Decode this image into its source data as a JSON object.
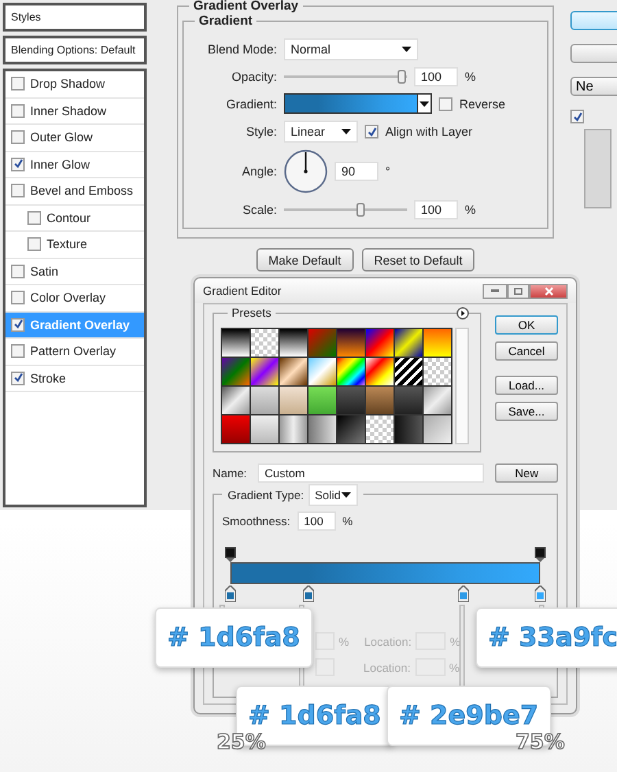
{
  "styles_panel": {
    "header": "Styles",
    "blending": "Blending Options: Default",
    "items": [
      {
        "label": "Drop Shadow",
        "checked": false,
        "selected": false
      },
      {
        "label": "Inner Shadow",
        "checked": false,
        "selected": false
      },
      {
        "label": "Outer Glow",
        "checked": false,
        "selected": false
      },
      {
        "label": "Inner Glow",
        "checked": true,
        "selected": false
      },
      {
        "label": "Bevel and Emboss",
        "checked": false,
        "selected": false,
        "children": [
          {
            "label": "Contour",
            "checked": false,
            "selected": false
          },
          {
            "label": "Texture",
            "checked": false,
            "selected": false
          }
        ]
      },
      {
        "label": "Satin",
        "checked": false,
        "selected": false
      },
      {
        "label": "Color Overlay",
        "checked": false,
        "selected": false
      },
      {
        "label": "Gradient Overlay",
        "checked": true,
        "selected": true
      },
      {
        "label": "Pattern Overlay",
        "checked": false,
        "selected": false
      },
      {
        "label": "Stroke",
        "checked": true,
        "selected": false
      }
    ]
  },
  "gradient_overlay": {
    "title": "Gradient Overlay",
    "section": "Gradient",
    "blend_mode": {
      "label": "Blend Mode:",
      "value": "Normal"
    },
    "opacity": {
      "label": "Opacity:",
      "level": 0.95,
      "value": "100",
      "unit": "%"
    },
    "gradient": {
      "label": "Gradient:",
      "reverse": {
        "label": "Reverse",
        "checked": false
      }
    },
    "style": {
      "label": "Style:",
      "value": "Linear",
      "align": {
        "label": "Align with Layer",
        "checked": true
      }
    },
    "angle": {
      "label": "Angle:",
      "value": "90",
      "unit": "°"
    },
    "scale": {
      "label": "Scale:",
      "level": 0.62,
      "value": "100",
      "unit": "%"
    },
    "buttons": [
      "Make Default",
      "Reset to Default"
    ]
  },
  "side_buttons": [
    {
      "primary": true
    },
    {
      "primary": false
    },
    {
      "label": "Ne",
      "primary": false
    }
  ],
  "preview": {
    "checked": true
  },
  "gradient_editor": {
    "title": "Gradient Editor",
    "presets_label": "Presets",
    "buttons": [
      "OK",
      "Cancel",
      "Load...",
      "Save..."
    ],
    "name": {
      "label": "Name:",
      "value": "Custom"
    },
    "new_button": "New",
    "gradient_type": {
      "label": "Gradient Type:",
      "value": "Solid"
    },
    "smoothness": {
      "label": "Smoothness:",
      "value": "100",
      "unit": "%"
    },
    "stop_rows": [
      {
        "unit": "%",
        "location_label": "Location:",
        "location_unit": "%"
      },
      {
        "location_label": "Location:",
        "location_unit": "%"
      }
    ],
    "stops": [
      {
        "level": 0,
        "color": "#1d6fa8",
        "text": "# 1d6fa8"
      },
      {
        "level": 0.25,
        "color": "#1d6fa8",
        "text": "# 1d6fa8"
      },
      {
        "level": 0.75,
        "color": "#2e9be7",
        "text": "# 2e9be7"
      },
      {
        "level": 1,
        "color": "#33a9fc",
        "text": "# 33a9fc"
      }
    ],
    "percent_labels": [
      "25%",
      "75%"
    ]
  }
}
